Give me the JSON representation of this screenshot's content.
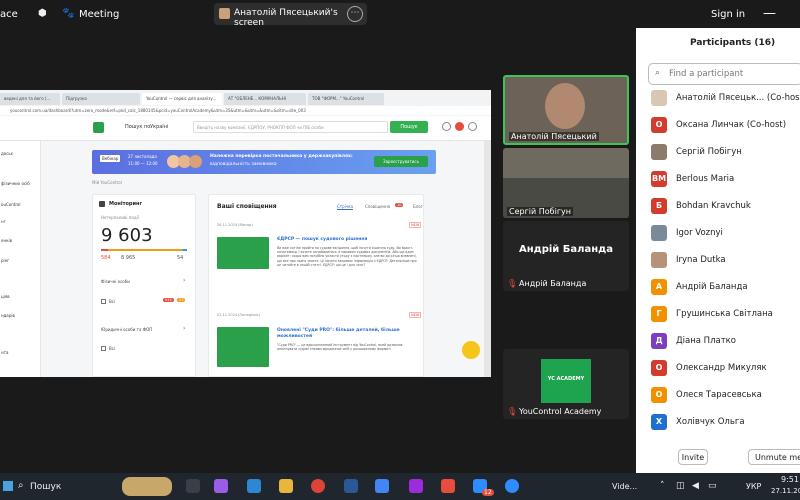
{
  "zoom": {
    "app_title": "ace",
    "meeting_label": "Meeting",
    "screen_share_label": "Анатолій Пясецький's screen",
    "sign_in": "Sign in"
  },
  "shared_screen": {
    "browser_tabs": [
      "ведені для та його (...",
      " Підгрузка",
      "YouControl — сервіс для аналізу...",
      "АТ \"ОБЛЕНЕ...  КОМУНАЛЬНІ",
      "ТОВ \"ФОРМ...\" YouControl"
    ],
    "url": "youcontrol.com.ua/dashboard/?utm=zero_mode&ref=pkd_calc_1880145&pcid=youControlAcademy&utm=35&utm=&utm=&utm=&sitm=site_003",
    "search_label": "Пошук по",
    "search_country": "Україні",
    "search_placeholder": "Введіть назву компанії, ЄДРПОУ, РНОКПП ФОП чи ПІБ особи",
    "search_button": "Пошук",
    "webinar_badge": "Вебінар",
    "webinar_date": "27 листопада",
    "webinar_time": "11:00 — 12:00",
    "banner_title": "Належна перевірка постачальника у держзакупівлях:",
    "banner_subtitle": "відповідальність замовника",
    "banner_button": "Зареєструватись",
    "breadcrumb": "Мій YouControl",
    "sidebar_items": [
      "досьє",
      "",
      "фізичних осіб",
      "",
      "ouControl",
      "нг",
      "",
      "енків",
      "",
      "рінг",
      "",
      "",
      "",
      "ціяв",
      "ндерів",
      "",
      "нта"
    ],
    "monitoring_title": "Моніторинг",
    "monitoring_sub": "Нетерпеливі події",
    "monitoring_count": "9 603",
    "monitoring_red": "584",
    "monitoring_mid": "8 965",
    "monitoring_right": "54",
    "individuals_label": "Фізичні особи",
    "all_label": "Всі",
    "badge_a": "544",
    "badge_b": "23",
    "legal_label": "Юридичні особи та ФОП",
    "notif_title": "Ваші сповіщення",
    "notif_tab1": "Стрічка",
    "notif_tab2": "Сповіщення",
    "notif_tab2_badge": "10",
    "notif_tab3": "Блог",
    "news1_date": "26.11.2024 (Вівтор)",
    "news1_tag": "NEW",
    "news1_title": "ЄДРСР — пошук судового рішення",
    "news1_body": "Ви вже хотіли прийти на судове засідання, щоб почути рішення суду. Ви юрист-початківець і хочете ознайомитись із масивом судових документів. Або ще один варіант: скоро вам потрібно укласти угоду з партнером, але ви до кінця впевнені, що все про нього знаєте. Ці запити закриває інформація з ЄДРСР. Детальніше про це читайте в нашій статті. ЄДРСР: що це і для чого?",
    "news2_date": "22.11.2024 (Понеділок)",
    "news2_tag": "NEW",
    "news2_title": "Оновлені \"Суди PRO\": більше деталей, більше можливостей",
    "news2_body": "\"Суди PRO\" — це вдосконалений інструмент від YouControl, який дозволяє аналізувати судові справи юридичних осіб у розширеному форматі"
  },
  "gallery": {
    "tile1_name": "Анатолій Пясецький",
    "tile2_name": "Сергій Побігун",
    "tile3_big": "Андрій Баланда",
    "tile3_name": "Андрій Баланда",
    "tile4_logo": "YC ACADEMY",
    "tile4_name": "YouControl Academy"
  },
  "participants": {
    "title": "Participants (16)",
    "search_placeholder": "Find a participant",
    "list": [
      {
        "name": "Анатолій Пясецьк... (Co-host)",
        "initials": "",
        "color": "#d9c7b4"
      },
      {
        "name": "Оксана Линчак (Co-host)",
        "initials": "О",
        "color": "#d33b2d"
      },
      {
        "name": "Сергій Побігун",
        "initials": "",
        "color": "#8c7a6a"
      },
      {
        "name": "Berlous Maria",
        "initials": "BM",
        "color": "#d33b2d"
      },
      {
        "name": "Bohdan Kravchuk",
        "initials": "Б",
        "color": "#d33b2d"
      },
      {
        "name": "Igor Voznyi",
        "initials": "",
        "color": "#7a8a99"
      },
      {
        "name": "Iryna Dutka",
        "initials": "",
        "color": "#b5927a"
      },
      {
        "name": "Андрій Баланда",
        "initials": "А",
        "color": "#f29100"
      },
      {
        "name": "Грушинська Світлана",
        "initials": "Г",
        "color": "#f29100"
      },
      {
        "name": "Діана Платко",
        "initials": "Д",
        "color": "#7b3fbf"
      },
      {
        "name": "Олександр Микуляк",
        "initials": "О",
        "color": "#d33b2d"
      },
      {
        "name": "Олеся Тарасевська",
        "initials": "О",
        "color": "#f29100"
      },
      {
        "name": "Холівчук Ольга",
        "initials": "Х",
        "color": "#1f6fd1"
      }
    ],
    "invite_button": "Invite",
    "unmute_button": "Unmute me"
  },
  "taskbar": {
    "search_label": "Пошук",
    "zoom_badge": "12",
    "vide_label": "Vide...",
    "lang": "УКР",
    "time": "9:51",
    "date": "27.11.20"
  }
}
